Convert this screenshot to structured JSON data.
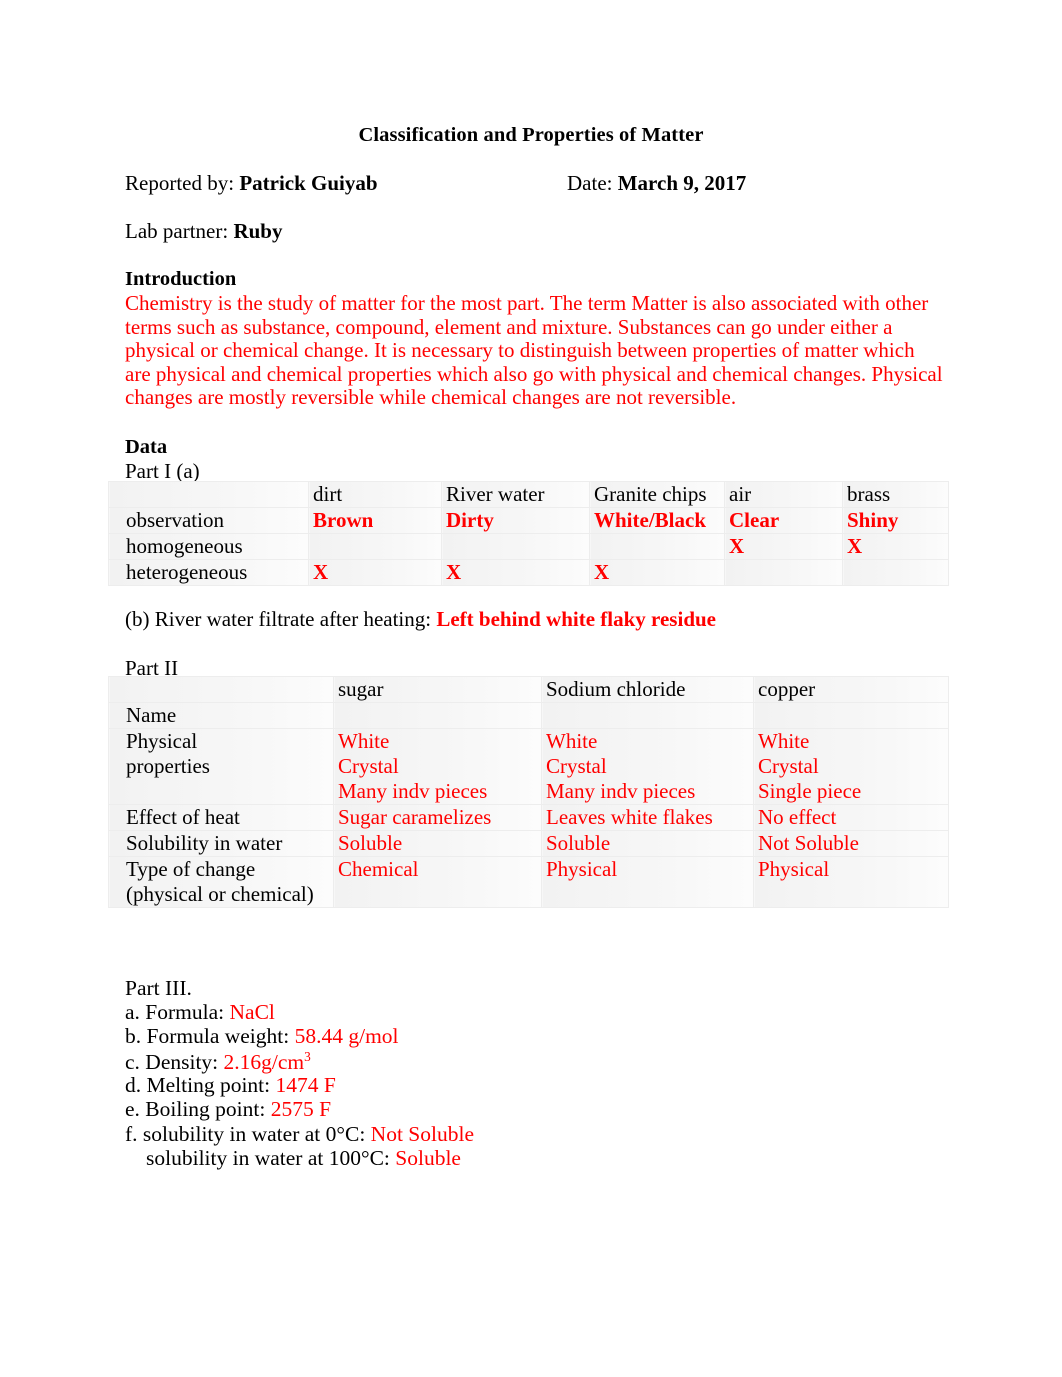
{
  "document": {
    "title": "Classification and Properties of Matter",
    "header": {
      "reported_by_label": "Reported by:",
      "reported_by_value": "Patrick Guiyab",
      "date_label": "Date:",
      "date_value": "March 9, 2017",
      "lab_partner_label": "Lab partner:",
      "lab_partner_value": "Ruby"
    },
    "introduction": {
      "heading": "Introduction",
      "body": "Chemistry is the study of matter for the most part. The term Matter is also associated with other terms such as substance, compound, element and mixture. Substances can go under either a physical or chemical change. It is necessary to distinguish between properties of matter which are physical and chemical properties which also go with physical and chemical changes. Physical changes are mostly reversible while chemical changes are not reversible."
    },
    "data": {
      "heading": "Data",
      "part1": {
        "label": "Part I (a)",
        "columns": [
          "",
          "dirt",
          "River water",
          "Granite chips",
          "air",
          "brass"
        ],
        "rows": [
          {
            "label": "observation",
            "cells": [
              "Brown",
              "Dirty",
              "White/Black",
              "Clear",
              "Shiny"
            ]
          },
          {
            "label": "homogeneous",
            "cells": [
              "",
              "",
              "",
              "X",
              "X"
            ]
          },
          {
            "label": "heterogeneous",
            "cells": [
              "X",
              "X",
              "X",
              "",
              ""
            ]
          }
        ]
      },
      "part1b": {
        "label": "(b) River water filtrate after heating:",
        "value": "Left behind white flaky residue"
      },
      "part2": {
        "label": "Part II",
        "columns": [
          "",
          "sugar",
          "Sodium chloride",
          "copper"
        ],
        "rows": [
          {
            "label": "Name",
            "cells": [
              "",
              "",
              ""
            ]
          },
          {
            "label": "Physical\nproperties",
            "label_lines": [
              "Physical",
              "properties"
            ],
            "cells_lines": [
              [
                "White",
                "Crystal",
                "Many indv pieces"
              ],
              [
                "White",
                "Crystal",
                "Many indv pieces"
              ],
              [
                "White",
                "Crystal",
                "Single piece"
              ]
            ]
          },
          {
            "label": "Effect of heat",
            "cells": [
              "Sugar caramelizes",
              "Leaves white flakes",
              "No effect"
            ]
          },
          {
            "label": "Solubility in water",
            "cells": [
              "Soluble",
              "Soluble",
              "Not Soluble"
            ]
          },
          {
            "label": "Type of change\n(physical or chemical)",
            "label_lines": [
              "Type of change",
              "(physical or chemical)"
            ],
            "cells": [
              "Chemical",
              "Physical",
              "Physical"
            ]
          }
        ]
      },
      "part3": {
        "title": "Part III.",
        "items": [
          {
            "key": "a. Formula:",
            "value": "NaCl"
          },
          {
            "key": "b. Formula weight:",
            "value": "58.44 g/mol"
          },
          {
            "key": "c. Density:",
            "value": "2.16g/cm",
            "superscript": "3"
          },
          {
            "key": "d. Melting point:",
            "value": "1474 F"
          },
          {
            "key": "e. Boiling point:",
            "value": "2575 F"
          },
          {
            "key": "f. solubility in water at 0°C:",
            "value": "Not Soluble"
          },
          {
            "key": "solubility in water at 100°C:",
            "value": "Soluble"
          }
        ]
      }
    },
    "colors": {
      "answer_red": "#FF0000",
      "text_black": "#000000",
      "table_fill": "#F4F4F4",
      "table_border": "#EDEDED"
    }
  }
}
